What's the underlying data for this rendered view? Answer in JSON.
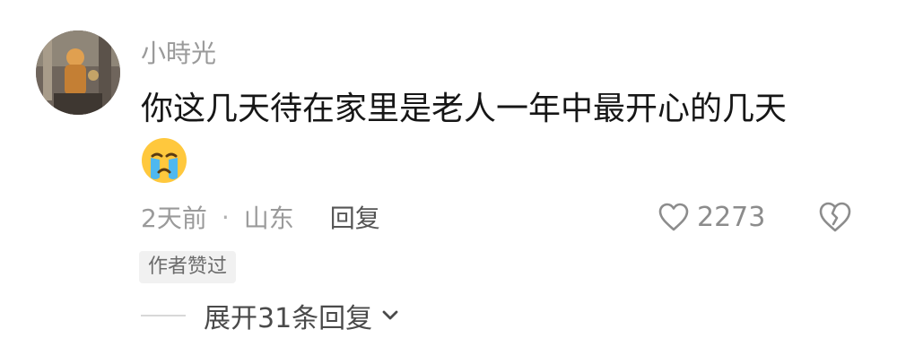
{
  "comment": {
    "username": "小時光",
    "text": "你这几天待在家里是老人一年中最开心的几天",
    "emoji": "crying-face-icon",
    "time": "2天前",
    "separator": "·",
    "location": "山东",
    "reply_label": "回复",
    "like_count": "2273",
    "author_liked_badge": "作者赞过",
    "expand_replies_label": "展开31条回复"
  },
  "colors": {
    "meta_gray": "#9a9a9a",
    "text_dark": "#161616",
    "badge_bg": "#f1f1f1"
  }
}
